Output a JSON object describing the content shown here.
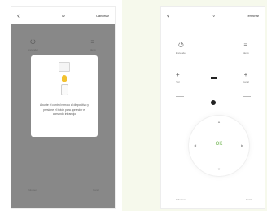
{
  "left_phone": {
    "header": {
      "back_icon": "‹",
      "title": "TV",
      "action": "Cancelar"
    },
    "controls": {
      "power": {
        "icon": "power-icon",
        "symbol": "⏻",
        "label": "Encender"
      },
      "menu": {
        "icon": "menu-icon",
        "symbol": "≡",
        "label": "Menú"
      },
      "bottom_left": {
        "label": "Volumen"
      },
      "bottom_right": {
        "label": "Canal"
      }
    },
    "dialog": {
      "text": "Apunte el control remoto al dispositivo y presione el botón para aprender el comando infrarrojo"
    }
  },
  "right_phone": {
    "header": {
      "back_icon": "‹",
      "title": "TV",
      "action": "Terminar"
    },
    "controls": {
      "power": {
        "symbol": "⏻",
        "label": "Encender"
      },
      "menu": {
        "symbol": "≡",
        "label": "Menú"
      },
      "vol_up": {
        "symbol": "+",
        "label": "Vol"
      },
      "ch_up": {
        "symbol": "+",
        "label": "Canal"
      },
      "bottom_left": {
        "label": "Volumen"
      },
      "bottom_right": {
        "label": "Canal"
      }
    },
    "dpad": {
      "ok_label": "OK",
      "up": "▲",
      "down": "▼",
      "left": "◀",
      "right": "▶"
    }
  },
  "colors": {
    "ok_green": "#6bb34a",
    "overlay": "#5a5a5a",
    "bulb": "#f2c230"
  }
}
